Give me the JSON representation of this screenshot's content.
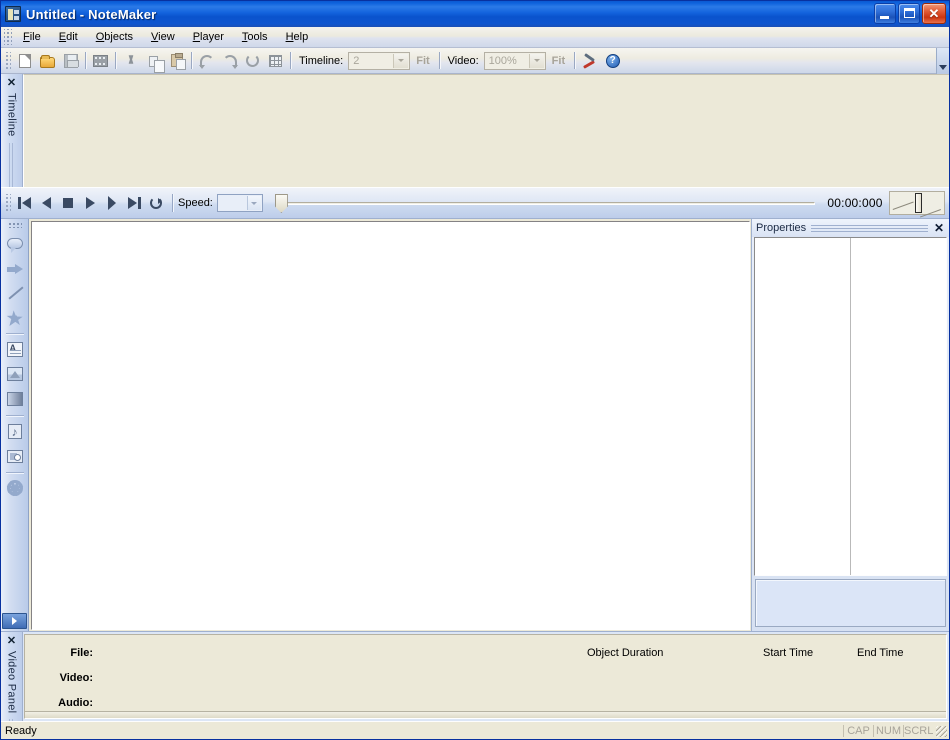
{
  "window": {
    "title_document": "Untitled",
    "title_separator": " - ",
    "title_app": "NoteMaker",
    "icon": "app-notemaker-icon",
    "buttons": {
      "minimize": "minimize-icon",
      "maximize": "maximize-icon",
      "close": "✕"
    }
  },
  "menubar": {
    "items": [
      {
        "label": "File",
        "accel": "F"
      },
      {
        "label": "Edit",
        "accel": "E"
      },
      {
        "label": "Objects",
        "accel": "O"
      },
      {
        "label": "View",
        "accel": "V"
      },
      {
        "label": "Player",
        "accel": "P"
      },
      {
        "label": "Tools",
        "accel": "T"
      },
      {
        "label": "Help",
        "accel": "H"
      }
    ]
  },
  "toolbar": {
    "buttons": [
      {
        "name": "new-icon",
        "tooltip": "New"
      },
      {
        "name": "open-icon",
        "tooltip": "Open"
      },
      {
        "name": "save-icon",
        "tooltip": "Save"
      },
      {
        "name": "film-icon",
        "tooltip": "Video"
      },
      {
        "name": "cut-icon",
        "tooltip": "Cut"
      },
      {
        "name": "copy-icon",
        "tooltip": "Copy"
      },
      {
        "name": "paste-icon",
        "tooltip": "Paste"
      },
      {
        "name": "undo-icon",
        "tooltip": "Undo"
      },
      {
        "name": "redo-icon",
        "tooltip": "Redo"
      },
      {
        "name": "refresh-icon",
        "tooltip": "Refresh"
      },
      {
        "name": "grid-icon",
        "tooltip": "Grid"
      },
      {
        "name": "tools-icon",
        "tooltip": "Options"
      },
      {
        "name": "help-icon",
        "tooltip": "Help"
      }
    ],
    "timeline_label": "Timeline:",
    "timeline_zoom_value": "2",
    "timeline_fit_label": "Fit",
    "video_label": "Video:",
    "video_zoom_value": "100%",
    "video_fit_label": "Fit",
    "help_glyph": "?",
    "overflow": "toolbar-overflow-chevron"
  },
  "timeline_panel": {
    "close_label": "✕",
    "title": "Timeline"
  },
  "player": {
    "buttons": [
      {
        "name": "go-to-start-button",
        "tooltip": "Go to start"
      },
      {
        "name": "step-back-button",
        "tooltip": "Step back"
      },
      {
        "name": "stop-button",
        "tooltip": "Stop"
      },
      {
        "name": "play-button",
        "tooltip": "Play"
      },
      {
        "name": "step-forward-button",
        "tooltip": "Step forward"
      },
      {
        "name": "go-to-end-button",
        "tooltip": "Go to end"
      },
      {
        "name": "loop-button",
        "tooltip": "Loop"
      }
    ],
    "speed_label": "Speed:",
    "speed_value": "",
    "time_display": "00:00:000"
  },
  "tool_palette": {
    "tools": [
      {
        "name": "callout-tool",
        "label": "Callout"
      },
      {
        "name": "arrow-tool",
        "label": "Arrow"
      },
      {
        "name": "line-tool",
        "label": "Line"
      },
      {
        "name": "star-tool",
        "label": "Star"
      },
      {
        "name": "textbox-tool",
        "label": "Text Box"
      },
      {
        "name": "image-tool",
        "label": "Image"
      },
      {
        "name": "shape-tool",
        "label": "Shape"
      },
      {
        "name": "audio-tool",
        "label": "Audio Note"
      },
      {
        "name": "video-tool",
        "label": "Video Note"
      },
      {
        "name": "settings-tool",
        "label": "Settings"
      }
    ],
    "overflow": "palette-overflow-chevron"
  },
  "properties_panel": {
    "title": "Properties",
    "close_label": "✕"
  },
  "video_panel": {
    "close_label": "✕",
    "title": "Video Panel",
    "rows": [
      {
        "label": "File:",
        "value": ""
      },
      {
        "label": "Video:",
        "value": ""
      },
      {
        "label": "Audio:",
        "value": ""
      }
    ],
    "columns": [
      {
        "label": "Object Duration"
      },
      {
        "label": "Start Time"
      },
      {
        "label": "End Time"
      }
    ]
  },
  "statusbar": {
    "message": "Ready",
    "indicators": [
      {
        "label": "CAP",
        "active": false
      },
      {
        "label": "NUM",
        "active": false
      },
      {
        "label": "SCRL",
        "active": false
      }
    ]
  },
  "colors": {
    "title_bar_blue": "#0a53cd",
    "close_button_red": "#cc3410",
    "client_beige": "#ece9d8",
    "dock_blue": "#bdcdea",
    "canvas_white": "#ffffff",
    "props_desc_blue": "#dbe5f7"
  }
}
